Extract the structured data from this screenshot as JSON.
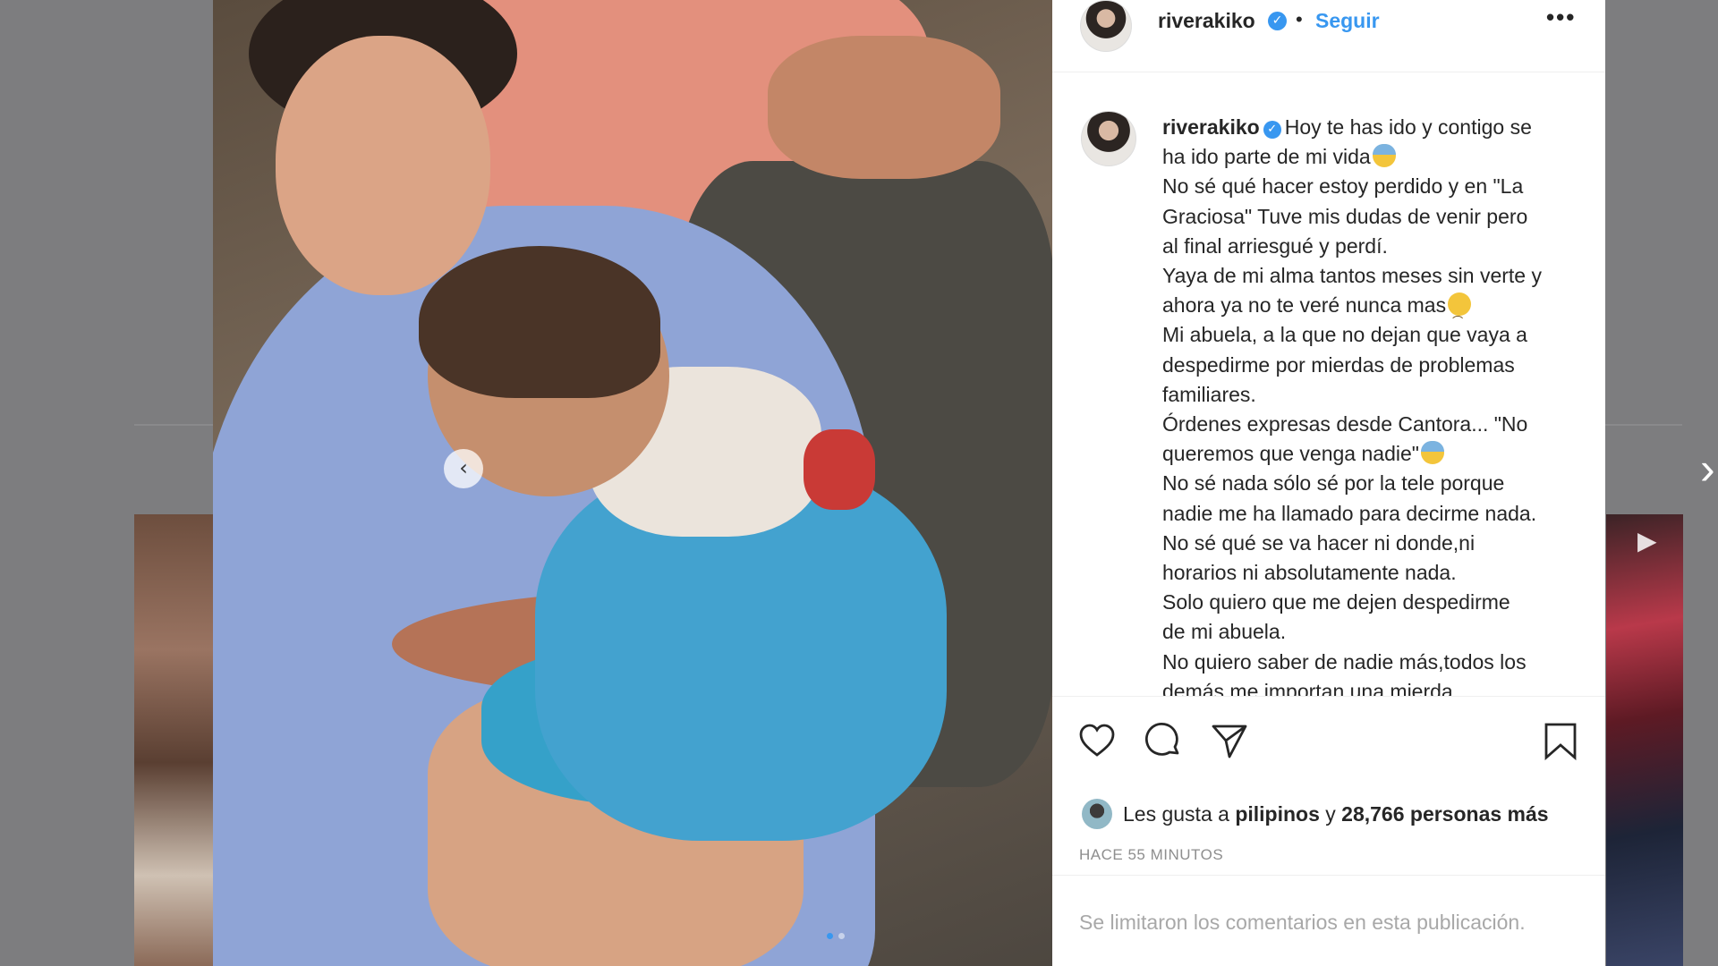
{
  "colors": {
    "accent": "#3897f0",
    "text": "#262626",
    "muted": "#8e8e8e",
    "backdrop": "#7d7d7f"
  },
  "post": {
    "image_description_icon": "photo-grandmother-child",
    "carousel": {
      "prev_icon": "chevron-left-icon",
      "next_icon": "chevron-right-icon",
      "slide_count": 2,
      "active_slide": 1
    },
    "header": {
      "username": "riverakiko",
      "separator": "•",
      "follow_label": "Seguir",
      "more_label": "•••"
    },
    "caption": {
      "username": "riverakiko",
      "lines": [
        "Hoy te has ido y contigo se",
        "ha ido parte de mi vida",
        "No sé qué hacer estoy perdido y en \"La",
        "Graciosa\" Tuve mis dudas de venir pero",
        "al final arriesgué y perdí.",
        "Yaya de mi alma tantos meses sin verte y",
        "ahora ya no te veré nunca mas",
        "Mi abuela, a la que no dejan que vaya a",
        "despedirme por mierdas de problemas",
        "familiares.",
        "Órdenes expresas desde Cantora... \"No",
        "queremos que venga nadie\"",
        "No sé nada sólo sé por la tele porque",
        "nadie me ha llamado para decirme nada.",
        "No sé qué se va hacer ni donde,ni",
        "horarios ni absolutamente nada.",
        "Solo quiero que me dejen despedirme",
        "de mi abuela.",
        "No quiero saber de nadie más,todos los",
        "demás me importan una mierda"
      ]
    },
    "likes": {
      "prefix": "Les gusta a",
      "user": "pilipinos",
      "connector": "y",
      "others": "28,766 personas más"
    },
    "timestamp": "HACE 55 MINUTOS",
    "comments_notice": "Se limitaron los comentarios en esta publicación."
  }
}
